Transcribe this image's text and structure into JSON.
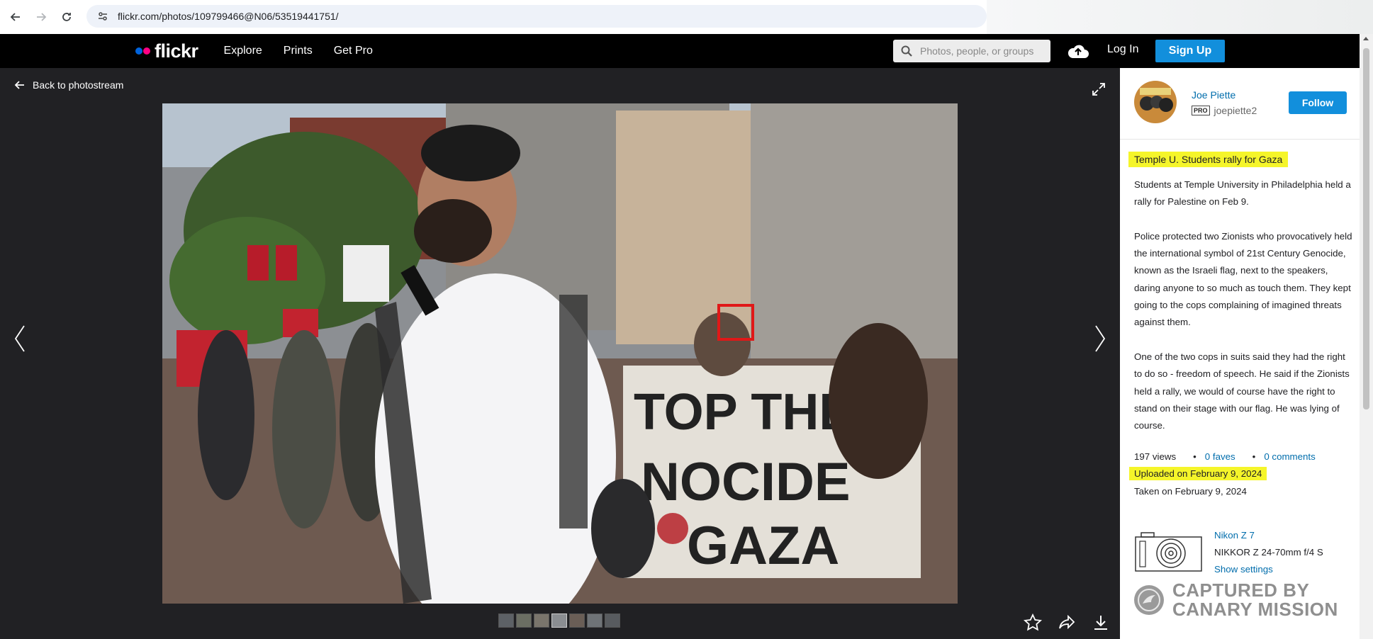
{
  "browser": {
    "url": "flickr.com/photos/109799466@N06/53519441751/"
  },
  "header": {
    "logo_text": "flickr",
    "nav": [
      "Explore",
      "Prints",
      "Get Pro"
    ],
    "search_placeholder": "Photos, people, or groups",
    "login_label": "Log In",
    "signup_label": "Sign Up"
  },
  "viewer": {
    "back_label": "Back to photostream",
    "thumbnail_count": 7,
    "photo_colors": {
      "background": "#212124"
    }
  },
  "sidebar": {
    "owner_name": "Joe Piette",
    "pro_badge": "PRO",
    "owner_username": "joepiette2",
    "follow_label": "Follow",
    "title": "Temple U. Students rally for Gaza",
    "description": [
      "Students at Temple University in Philadelphia held a rally for Palestine on Feb 9.",
      "Police protected two Zionists who provocatively held the international symbol of 21st Century Genocide, known as the Israeli flag, next to the speakers, daring anyone to so much as touch them. They kept going to the cops complaining of imagined threats against them.",
      "One of the two cops in suits said they had the right to do so - freedom of speech. He said if the Zionists held a rally, we would of course have the right to stand on their stage with our flag. He was lying of course."
    ],
    "views": "197 views",
    "faves": "0 faves",
    "comments": "0 comments",
    "uploaded": "Uploaded on February 9, 2024",
    "taken": "Taken on February 9, 2024",
    "camera_model": "Nikon Z 7",
    "lens": "NIKKOR Z 24-70mm f/4 S",
    "show_settings": "Show settings"
  },
  "watermark": {
    "line1": "CAPTURED BY",
    "line2": "CANARY MISSION"
  },
  "colors": {
    "accent": "#128fdc",
    "link": "#006dac",
    "highlight": "#f5f52a",
    "header_bg": "#000000"
  }
}
